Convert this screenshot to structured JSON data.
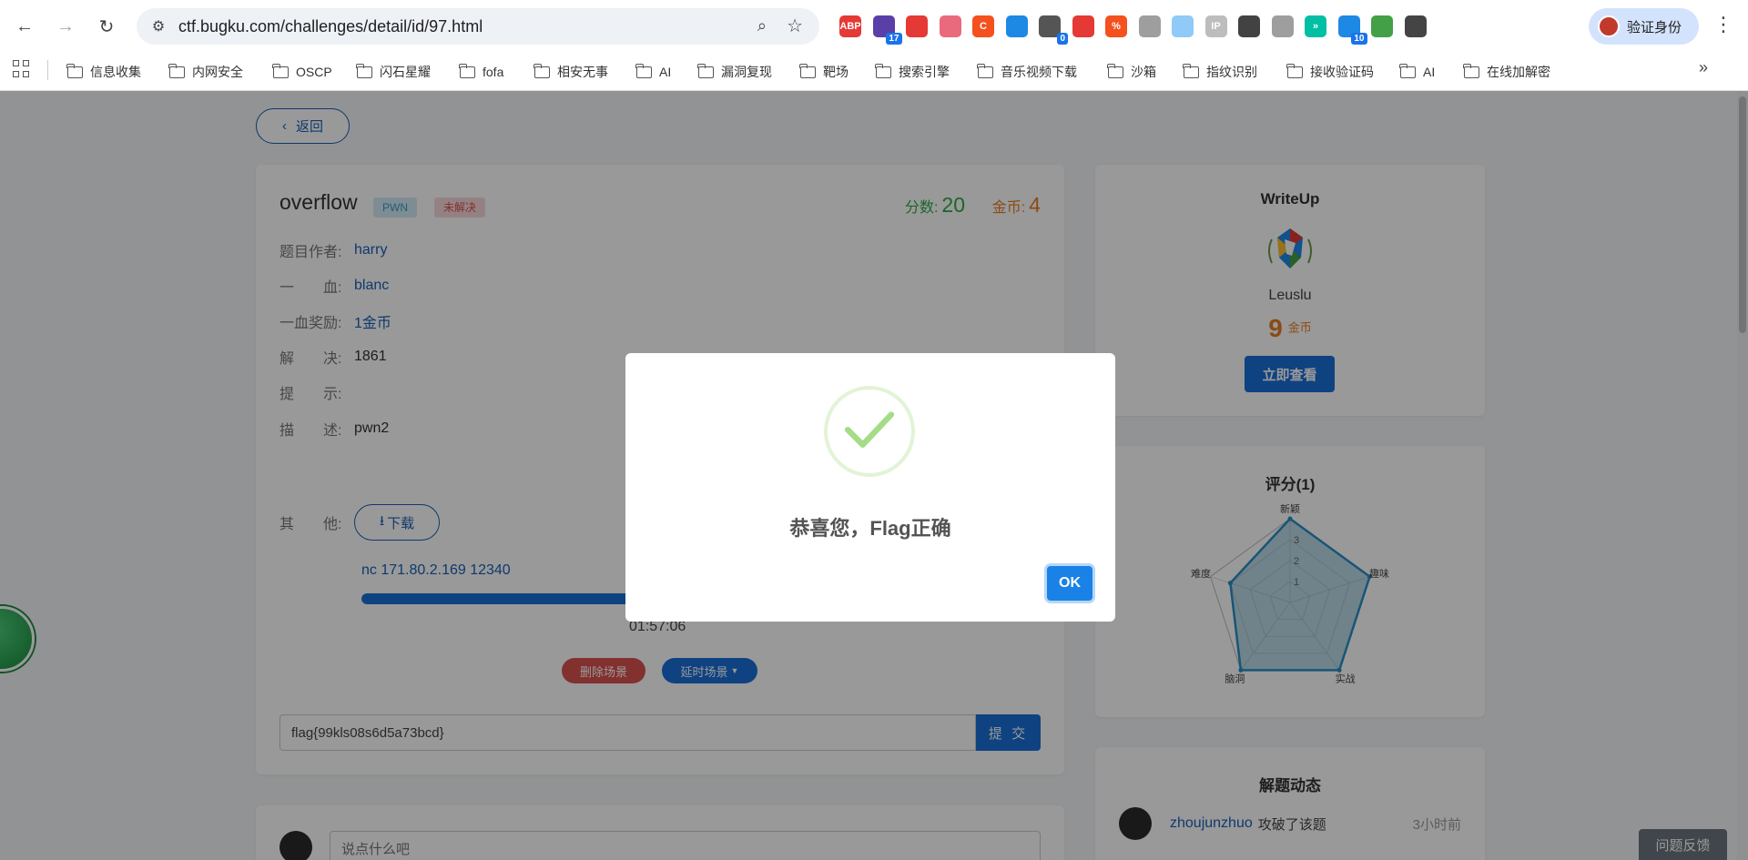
{
  "browser": {
    "url": "ctf.bugku.com/challenges/detail/id/97.html",
    "profile_label": "验证身份",
    "extensions": [
      {
        "name": "abp-extension-icon",
        "label": "ABP",
        "color": "#e53935",
        "badge": ""
      },
      {
        "name": "mortarboard-extension-icon",
        "label": "",
        "color": "#5b3fa8",
        "badge": "17"
      },
      {
        "name": "red-shield-extension-icon",
        "label": "",
        "color": "#e53935",
        "badge": ""
      },
      {
        "name": "pink-shield-extension-icon",
        "label": "",
        "color": "#e96a7d",
        "badge": ""
      },
      {
        "name": "c-extension-icon",
        "label": "C",
        "color": "#f4511e",
        "badge": ""
      },
      {
        "name": "color-circle-extension-icon",
        "label": "",
        "color": "#1e88e5",
        "badge": ""
      },
      {
        "name": "dots-extension-icon",
        "label": "",
        "color": "#555555",
        "badge": "0"
      },
      {
        "name": "noodle-extension-icon",
        "label": "",
        "color": "#e53935",
        "badge": ""
      },
      {
        "name": "percent-extension-icon",
        "label": "%",
        "color": "#f4511e",
        "badge": ""
      },
      {
        "name": "puzzle-gray-extension-icon",
        "label": "",
        "color": "#9e9e9e",
        "badge": ""
      },
      {
        "name": "tower-extension-icon",
        "label": "",
        "color": "#90caf9",
        "badge": ""
      },
      {
        "name": "ip-extension-icon",
        "label": "IP",
        "color": "#bdbdbd",
        "badge": ""
      },
      {
        "name": "mouse-extension-icon",
        "label": "",
        "color": "#424242",
        "badge": ""
      },
      {
        "name": "wheel-extension-icon",
        "label": "",
        "color": "#9e9e9e",
        "badge": ""
      },
      {
        "name": "chevrons-extension-icon",
        "label": "»",
        "color": "#00bfa5",
        "badge": ""
      },
      {
        "name": "cloud-extension-icon",
        "label": "",
        "color": "#1e88e5",
        "badge": "10"
      },
      {
        "name": "leaf-extension-icon",
        "label": "",
        "color": "#43a047",
        "badge": ""
      },
      {
        "name": "puzzle-extension-icon",
        "label": "",
        "color": "#444444",
        "badge": ""
      }
    ],
    "bookmarks": [
      "信息收集",
      "内网安全",
      "OSCP",
      "闪石星耀",
      "fofa",
      "相安无事",
      "AI",
      "漏洞复现",
      "靶场",
      "搜索引擎",
      "音乐视频下载",
      "沙箱",
      "指纹识别",
      "接收验证码",
      "AI",
      "在线加解密"
    ]
  },
  "page": {
    "back_label": "返回",
    "challenge": {
      "title": "overflow",
      "category_tag": "PWN",
      "status_tag": "未解决",
      "score_label": "分数:",
      "score": "20",
      "coin_label": "金币:",
      "coins": "4",
      "author_label": "题目作者:",
      "author": "harry",
      "first_blood_label": "一　　血:",
      "first_blood": "blanc",
      "first_blood_reward_label": "一血奖励:",
      "first_blood_reward": "1金币",
      "solved_label": "解　　决:",
      "solved": "1861",
      "hint_label": "提　　示:",
      "hint": "",
      "desc_label": "描　　述:",
      "desc": "pwn2",
      "other_label": "其　　他:",
      "download_label": "下载",
      "nc_command": "nc 171.80.2.169 12340",
      "progress_fraction": 0.73,
      "timer": "01:57:06",
      "delete_scene_label": "删除场景",
      "extend_scene_label": "延时场景",
      "flag_value": "flag{99kls08s6d5a73bcd}",
      "submit_label": "提 交"
    },
    "comment": {
      "placeholder": "说点什么吧"
    },
    "writeup": {
      "title": "WriteUp",
      "author": "Leuslu",
      "coins": "9",
      "coins_unit": "金币",
      "view_label": "立即查看"
    },
    "rating": {
      "title": "评分(1)",
      "axes": [
        "脑洞",
        "难度",
        "新颖",
        "趣味",
        "实战"
      ],
      "tick_labels": [
        "1",
        "2",
        "3"
      ],
      "values": [
        4,
        3,
        4,
        4,
        4
      ],
      "max": 4
    },
    "activity": {
      "title": "解题动态",
      "items": [
        {
          "user": "zhoujunzhuo",
          "action": "攻破了该题",
          "time": "3小时前"
        }
      ]
    },
    "feedback_label": "问题反馈"
  },
  "modal": {
    "message": "恭喜您，Flag正确",
    "ok_label": "OK"
  },
  "colors": {
    "primary": "#1a6ed8",
    "success": "#2eaa47",
    "coin": "#e67e22",
    "danger": "#d9534f",
    "check_green": "#a5dc86"
  }
}
